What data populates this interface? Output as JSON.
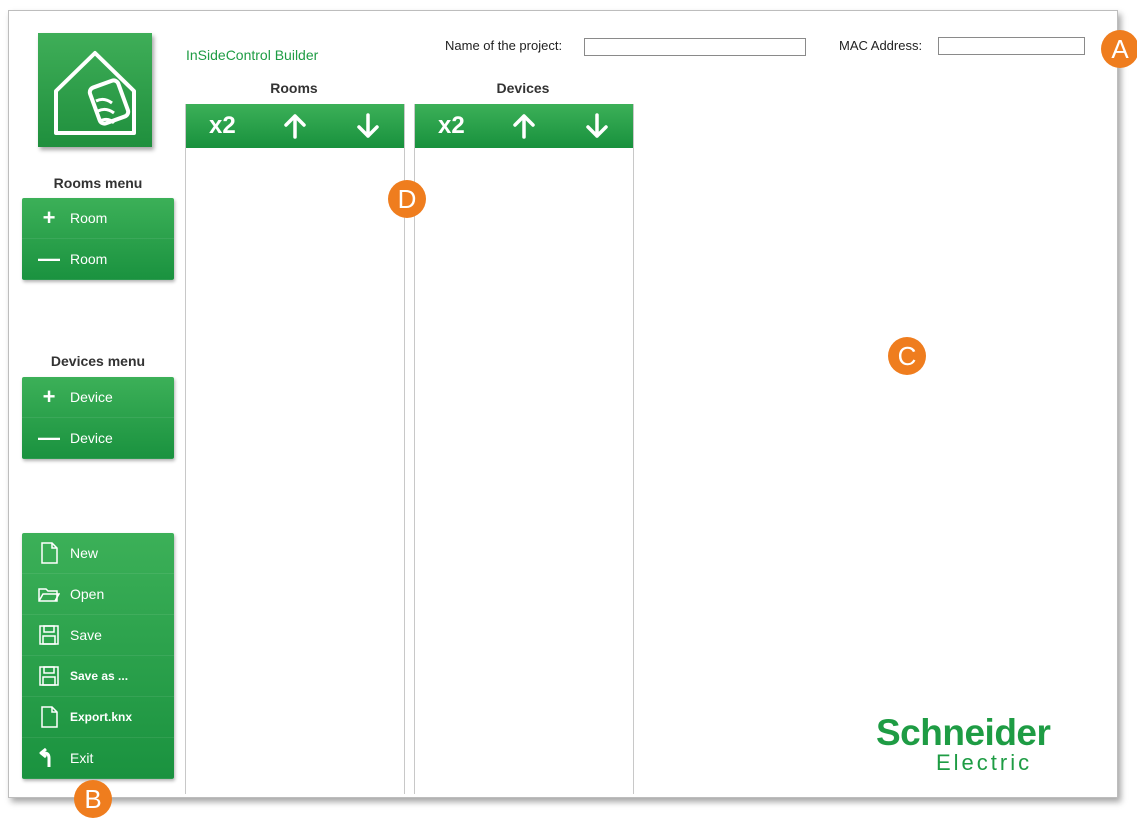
{
  "app": {
    "title": "InSideControl Builder"
  },
  "header": {
    "project_label": "Name of the project:",
    "project_value": "",
    "mac_label": "MAC Address:",
    "mac_value": ""
  },
  "columns": {
    "rooms": {
      "title": "Rooms",
      "duplicate_label": "x2",
      "up_icon": "arrow-up-icon",
      "down_icon": "arrow-down-icon"
    },
    "devices": {
      "title": "Devices",
      "duplicate_label": "x2",
      "up_icon": "arrow-up-icon",
      "down_icon": "arrow-down-icon"
    }
  },
  "rooms_menu": {
    "title": "Rooms menu",
    "items": [
      {
        "icon": "plus-icon",
        "label": "Room"
      },
      {
        "icon": "minus-icon",
        "label": "Room"
      }
    ]
  },
  "devices_menu": {
    "title": "Devices menu",
    "items": [
      {
        "icon": "plus-icon",
        "label": "Device"
      },
      {
        "icon": "minus-icon",
        "label": "Device"
      }
    ]
  },
  "file_menu": {
    "items": [
      {
        "icon": "new-file-icon",
        "label": "New"
      },
      {
        "icon": "open-folder-icon",
        "label": "Open"
      },
      {
        "icon": "save-disk-icon",
        "label": "Save"
      },
      {
        "icon": "save-as-disk-icon",
        "label": "Save as ..."
      },
      {
        "icon": "export-file-icon",
        "label": "Export.knx"
      },
      {
        "icon": "exit-arrow-icon",
        "label": "Exit"
      }
    ]
  },
  "callouts": {
    "a": "A",
    "b": "B",
    "c": "C",
    "d": "D"
  },
  "footer": {
    "brand_line1": "Schneider",
    "brand_line2": "Electric"
  },
  "colors": {
    "green": "#1e9c44",
    "orange": "#ef7d1e"
  }
}
